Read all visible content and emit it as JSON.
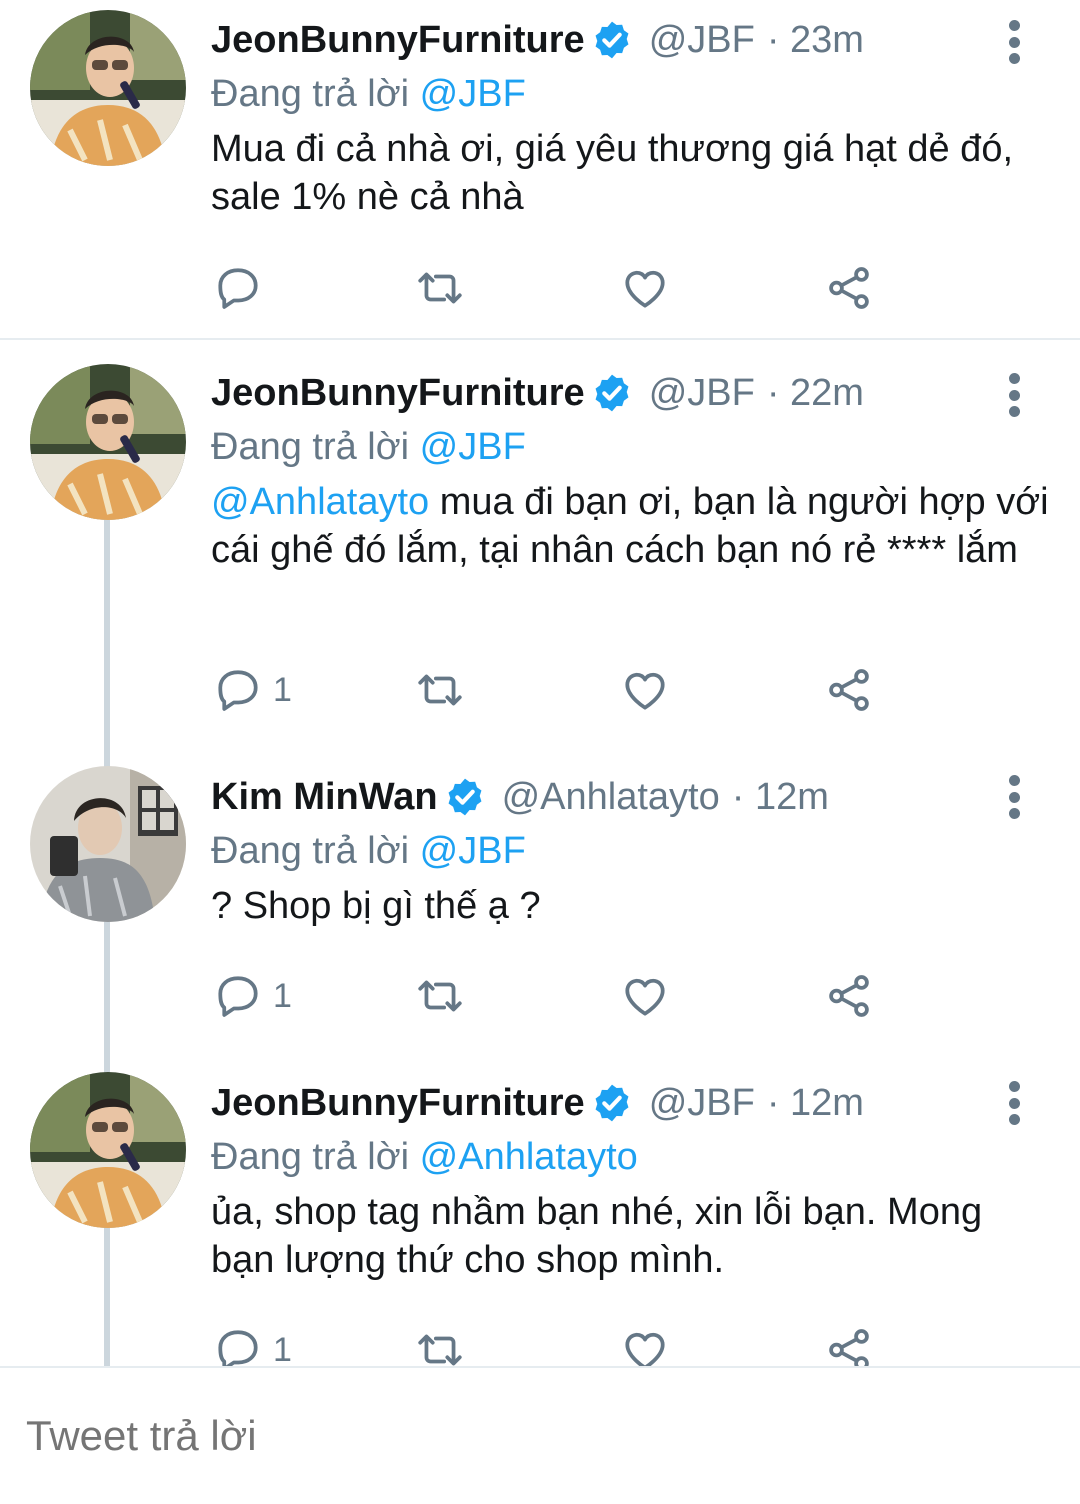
{
  "tweets": [
    {
      "name": "JeonBunnyFurniture",
      "handle": "@JBF",
      "time": "· 23m",
      "reply_prefix": "Đang trả lời",
      "reply_to": "@JBF",
      "mention": "",
      "text": "Mua đi cả nhà ơi, giá yêu thương giá hạt dẻ đó, sale 1% nè cả nhà",
      "reply_count": "",
      "verified": true,
      "avatar_icon": "user-avatar-orange-shirt-mic"
    },
    {
      "name": "JeonBunnyFurniture",
      "handle": "@JBF",
      "time": "· 22m",
      "reply_prefix": "Đang trả lời",
      "reply_to": "@JBF",
      "mention": "@Anhlatayto",
      "text": " mua đi bạn ơi, bạn là người hợp với cái ghế đó lắm, tại nhân cách bạn nó rẻ **** lắm",
      "reply_count": "1",
      "verified": true,
      "avatar_icon": "user-avatar-orange-shirt-mic"
    },
    {
      "name": "Kim MinWan",
      "handle": "@Anhlatayto",
      "time": "· 12m",
      "reply_prefix": "Đang trả lời",
      "reply_to": "@JBF",
      "mention": "",
      "text": "? Shop bị gì thế ạ ?",
      "reply_count": "1",
      "verified": true,
      "avatar_icon": "user-avatar-grey-selfie"
    },
    {
      "name": "JeonBunnyFurniture",
      "handle": "@JBF",
      "time": "· 12m",
      "reply_prefix": "Đang trả lời",
      "reply_to": "@Anhlatayto",
      "mention": "",
      "text": "ủa, shop tag nhầm bạn nhé, xin lỗi bạn. Mong bạn lượng thứ cho shop mình.",
      "reply_count": "1",
      "verified": true,
      "avatar_icon": "user-avatar-orange-shirt-mic"
    }
  ],
  "action_icons": [
    "reply-icon",
    "retweet-icon",
    "like-icon",
    "share-icon"
  ],
  "composer": {
    "placeholder": "Tweet trả lời"
  },
  "colors": {
    "link": "#1da1f2",
    "secondary_text": "#657786",
    "primary_text": "#14171a",
    "divider": "#e6ecf0",
    "thread_line": "#ccd6dd"
  }
}
